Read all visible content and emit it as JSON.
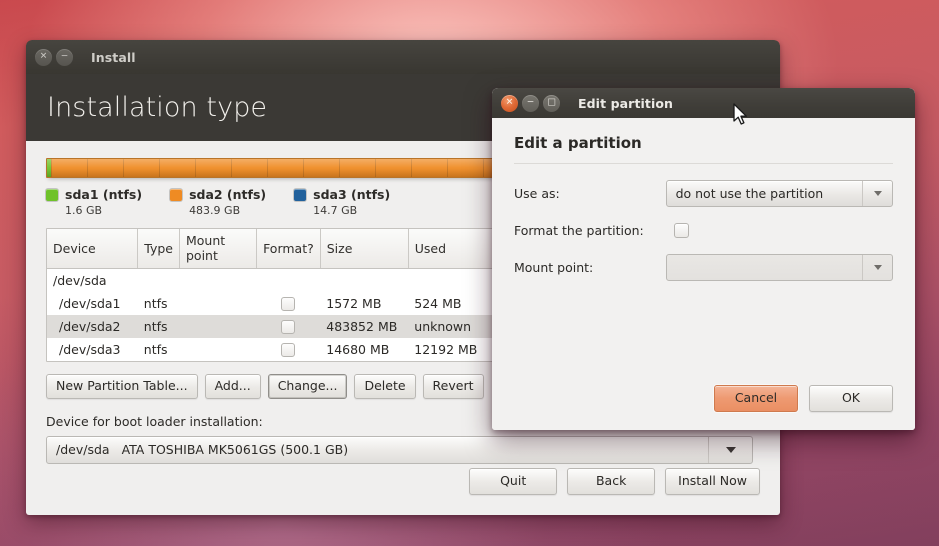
{
  "install_window": {
    "title": "Install",
    "window_buttons": [
      {
        "name": "close",
        "glyph": "✕"
      },
      {
        "name": "minimize",
        "glyph": "−"
      }
    ],
    "page_title": "Installation type",
    "disk_bar": {
      "segments": [
        {
          "label": "sda1",
          "color": "#6fc22a",
          "percent": 0.6
        },
        {
          "label": "sda2",
          "color": "#ef8b23",
          "percent": 96.5
        },
        {
          "label": "sda3",
          "color": "#21619c",
          "percent": 2.9
        }
      ]
    },
    "legend": [
      {
        "name": "sda1 (ntfs)",
        "size": "1.6 GB",
        "color": "#6fc22a"
      },
      {
        "name": "sda2 (ntfs)",
        "size": "483.9 GB",
        "color": "#ef8b23"
      },
      {
        "name": "sda3 (ntfs)",
        "size": "14.7 GB",
        "color": "#21619c"
      }
    ],
    "table": {
      "headers": [
        "Device",
        "Type",
        "Mount point",
        "Format?",
        "Size",
        "Used"
      ],
      "rows": [
        {
          "device": "/dev/sda",
          "type": "",
          "mount": "",
          "format": false,
          "size": "",
          "used": "",
          "is_disk": true,
          "selected": false
        },
        {
          "device": "/dev/sda1",
          "type": "ntfs",
          "mount": "",
          "format": false,
          "size": "1572 MB",
          "used": "524 MB",
          "is_disk": false,
          "selected": false
        },
        {
          "device": "/dev/sda2",
          "type": "ntfs",
          "mount": "",
          "format": false,
          "size": "483852 MB",
          "used": "unknown",
          "is_disk": false,
          "selected": true
        },
        {
          "device": "/dev/sda3",
          "type": "ntfs",
          "mount": "",
          "format": false,
          "size": "14680 MB",
          "used": "12192 MB",
          "is_disk": false,
          "selected": false
        }
      ]
    },
    "partition_actions": [
      {
        "label": "New Partition Table...",
        "focused": false
      },
      {
        "label": "Add...",
        "focused": false
      },
      {
        "label": "Change...",
        "focused": true
      },
      {
        "label": "Delete",
        "focused": false
      },
      {
        "label": "Revert",
        "focused": false
      }
    ],
    "bootloader": {
      "label": "Device for boot loader installation:",
      "device": "/dev/sda",
      "description": "ATA TOSHIBA MK5061GS (500.1 GB)"
    },
    "footer_actions": [
      {
        "label": "Quit"
      },
      {
        "label": "Back"
      },
      {
        "label": "Install Now"
      }
    ]
  },
  "edit_dialog": {
    "title": "Edit partition",
    "window_buttons": [
      {
        "name": "close",
        "glyph": "✕"
      },
      {
        "name": "minimize",
        "glyph": "−"
      },
      {
        "name": "maximize",
        "glyph": "□"
      }
    ],
    "heading": "Edit a partition",
    "use_as": {
      "label": "Use as:",
      "value": "do not use the partition"
    },
    "format_partition": {
      "label": "Format the partition:",
      "checked": false
    },
    "mount_point": {
      "label": "Mount point:",
      "value": ""
    },
    "actions": [
      {
        "label": "Cancel",
        "highlighted": true
      },
      {
        "label": "OK",
        "highlighted": false
      }
    ]
  },
  "colors": {
    "accent_orange": "#ef8b23",
    "green": "#6fc22a",
    "blue": "#21619c",
    "header_dark": "#3b3935",
    "body_bg": "#f0efee",
    "cancel_highlight": "#ee9a72"
  }
}
